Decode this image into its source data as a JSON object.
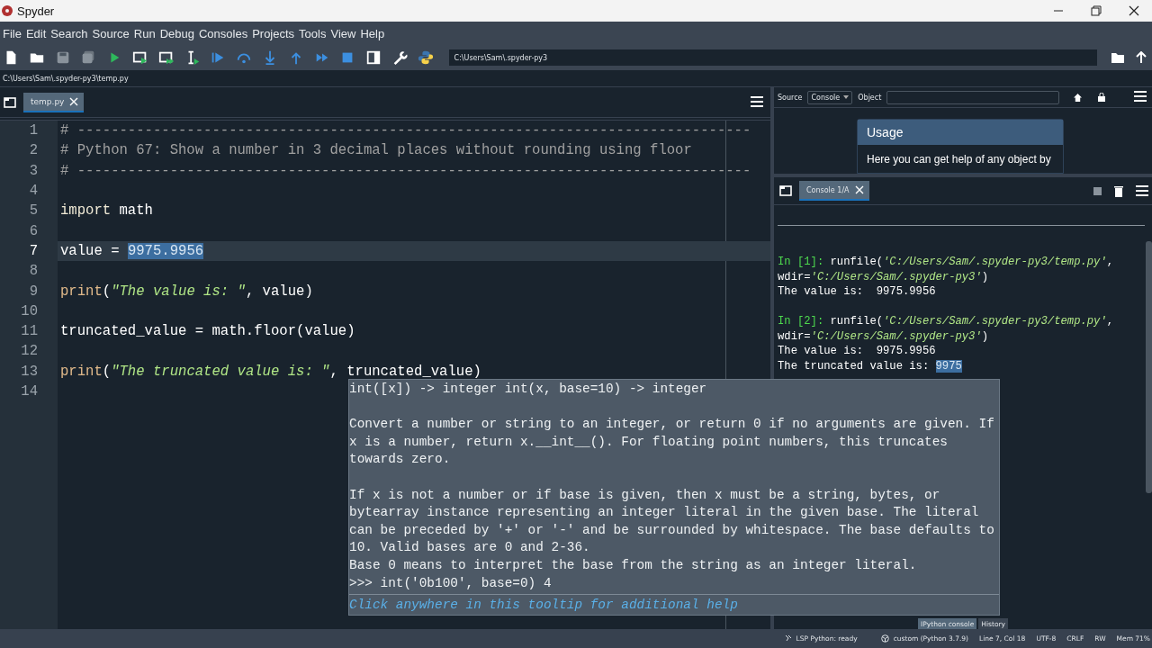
{
  "window": {
    "title": "Spyder"
  },
  "menu": [
    "File",
    "Edit",
    "Search",
    "Source",
    "Run",
    "Debug",
    "Consoles",
    "Projects",
    "Tools",
    "View",
    "Help"
  ],
  "toolbar": {
    "working_directory": "C:\\Users\\Sam\\.spyder-py3"
  },
  "path_bar": "C:\\Users\\Sam\\.spyder-py3\\temp.py",
  "editor": {
    "tabs": [
      {
        "label": "temp.py",
        "selected": true
      }
    ],
    "lines": [
      {
        "number": "1",
        "current": false,
        "tokens": [
          {
            "text": "# --------------------------------------------------------------------------------",
            "kind": "comment"
          }
        ]
      },
      {
        "number": "2",
        "current": false,
        "tokens": [
          {
            "text": "# Python 67: Show a number in 3 decimal places without rounding using floor",
            "kind": "comment"
          }
        ]
      },
      {
        "number": "3",
        "current": false,
        "tokens": [
          {
            "text": "# --------------------------------------------------------------------------------",
            "kind": "comment"
          }
        ]
      },
      {
        "number": "4",
        "current": false
      },
      {
        "number": "5",
        "current": false,
        "tokens": [
          {
            "text": "import",
            "kind": "keyword"
          },
          {
            "text": " math",
            "kind": "plain"
          }
        ]
      },
      {
        "number": "6",
        "current": false
      },
      {
        "number": "7",
        "current": true,
        "tokens": [
          {
            "text": "value = ",
            "kind": "plain"
          },
          {
            "text": "9975.9956",
            "kind": "selection"
          }
        ]
      },
      {
        "number": "8",
        "current": false
      },
      {
        "number": "9",
        "current": false,
        "tokens": [
          {
            "text": "print",
            "kind": "builtin"
          },
          {
            "text": "(",
            "kind": "plain"
          },
          {
            "text": "\"The value is: \"",
            "kind": "string"
          },
          {
            "text": ", value)",
            "kind": "plain"
          }
        ]
      },
      {
        "number": "10",
        "current": false
      },
      {
        "number": "11",
        "current": false,
        "tokens": [
          {
            "text": "truncated_value = math.floor(value)",
            "kind": "plain"
          }
        ]
      },
      {
        "number": "12",
        "current": false
      },
      {
        "number": "13",
        "current": false,
        "tokens": [
          {
            "text": "print",
            "kind": "builtin"
          },
          {
            "text": "(",
            "kind": "plain"
          },
          {
            "text": "\"The truncated value is: \"",
            "kind": "string"
          },
          {
            "text": ", truncated_value)",
            "kind": "plain"
          }
        ]
      },
      {
        "number": "14",
        "current": false
      }
    ]
  },
  "tooltip": {
    "signature": "int([x]) -> integer int(x, base=10) -> integer",
    "paragraphs": [
      [
        "Convert a number or string to an integer, or return 0 if no arguments are given. If",
        "x is a number, return x.__int__(). For floating point numbers, this truncates",
        "towards zero."
      ],
      [
        "If x is not a number or if base is given, then x must be a string, bytes, or",
        "bytearray instance representing an integer literal in the given base. The literal",
        "can be preceded by '+' or '-' and be surrounded by whitespace. The base defaults to",
        "10. Valid bases are 0 and 2-36.",
        "Base 0 means to interpret the base from the string as an integer literal.",
        ">>> int('0b100', base=0) 4"
      ]
    ],
    "footer": "Click anywhere in this tooltip for additional help"
  },
  "help": {
    "source_label": "Source",
    "source_value": "Console",
    "object_label": "Object",
    "usage_title": "Usage",
    "usage_text": "Here you can get help of any object by"
  },
  "console": {
    "tabs": [
      {
        "label": "Console 1/A",
        "selected": true
      }
    ],
    "blocks": [
      [
        [
          {
            "text": "In [1]:",
            "kind": "prompt"
          },
          {
            "text": " runfile(",
            "kind": "plain"
          },
          {
            "text": "'C:/Users/Sam/.spyder-py3/temp.py'",
            "kind": "string"
          },
          {
            "text": ",",
            "kind": "plain"
          }
        ],
        [
          {
            "text": "wdir=",
            "kind": "plain"
          },
          {
            "text": "'C:/Users/Sam/.spyder-py3'",
            "kind": "string"
          },
          {
            "text": ")",
            "kind": "plain"
          }
        ],
        [
          {
            "text": "The value is:  9975.9956",
            "kind": "plain"
          }
        ]
      ],
      [
        [
          {
            "text": "In [2]:",
            "kind": "prompt"
          },
          {
            "text": " runfile(",
            "kind": "plain"
          },
          {
            "text": "'C:/Users/Sam/.spyder-py3/temp.py'",
            "kind": "string"
          },
          {
            "text": ",",
            "kind": "plain"
          }
        ],
        [
          {
            "text": "wdir=",
            "kind": "plain"
          },
          {
            "text": "'C:/Users/Sam/.spyder-py3'",
            "kind": "string"
          },
          {
            "text": ")",
            "kind": "plain"
          }
        ],
        [
          {
            "text": "The value is:  9975.9956",
            "kind": "plain"
          }
        ],
        [
          {
            "text": "The truncated value is: ",
            "kind": "plain"
          },
          {
            "text": "9975",
            "kind": "selection"
          }
        ]
      ]
    ]
  },
  "pane_tabs": [
    {
      "label": "IPython console",
      "selected": true
    },
    {
      "label": "History",
      "selected": false
    }
  ],
  "status_bar": [
    {
      "text": "LSP Python: ready",
      "kind": "lsp"
    },
    {
      "text": "custom (Python 3.7.9)",
      "kind": "env"
    },
    {
      "text": "Line 7, Col 18",
      "kind": "plain"
    },
    {
      "text": "UTF-8",
      "kind": "plain"
    },
    {
      "text": "CRLF",
      "kind": "plain"
    },
    {
      "text": "RW",
      "kind": "plain"
    },
    {
      "text": "Mem 71%",
      "kind": "plain"
    }
  ]
}
